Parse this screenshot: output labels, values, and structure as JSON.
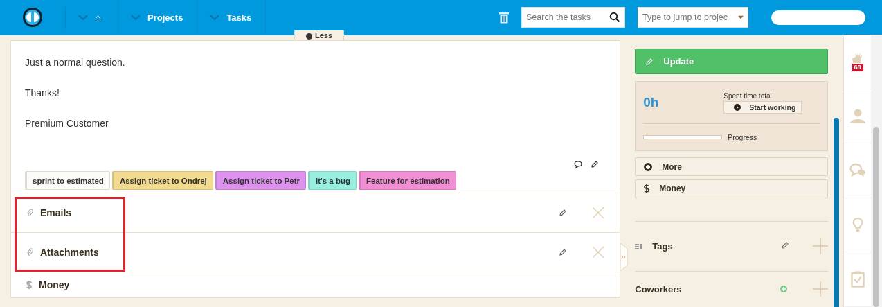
{
  "header": {
    "nav": [
      {
        "kind": "home",
        "label": "⌂"
      },
      {
        "kind": "text",
        "label": "Projects"
      },
      {
        "kind": "text",
        "label": "Tasks"
      }
    ],
    "search": {
      "placeholder": "Search the tasks"
    },
    "jump": {
      "placeholder": "Type to jump to projec"
    }
  },
  "description": {
    "toggle": "Less",
    "paragraphs": [
      "Just a normal question.",
      "Thanks!",
      "Premium Customer"
    ]
  },
  "tags": [
    {
      "label": "sprint to estimated",
      "color": "#fdfbf7"
    },
    {
      "label": "Assign ticket to Ondrej",
      "color": "#f2db8f"
    },
    {
      "label": "Assign ticket to Petr",
      "color": "#dd92ee"
    },
    {
      "label": "It's a bug",
      "color": "#98efe0"
    },
    {
      "label": "Feature for estimation",
      "color": "#f08fd4"
    }
  ],
  "sections": [
    {
      "kind": "attachment",
      "label": "Emails",
      "highlighted": true
    },
    {
      "kind": "attachment",
      "label": "Attachments",
      "highlighted": true
    },
    {
      "kind": "money",
      "label": "Money",
      "highlighted": false
    }
  ],
  "sidebar": {
    "update": "Update",
    "time": "0h",
    "spent_label": "Spent time total",
    "start": "Start working",
    "progress": {
      "label": "Progress",
      "level": 0
    },
    "actions": [
      {
        "kind": "more",
        "label": "More"
      },
      {
        "kind": "money",
        "label": "Money"
      }
    ],
    "tags_title": "Tags",
    "coworkers_title": "Coworkers"
  },
  "rail": {
    "badge": "68"
  }
}
